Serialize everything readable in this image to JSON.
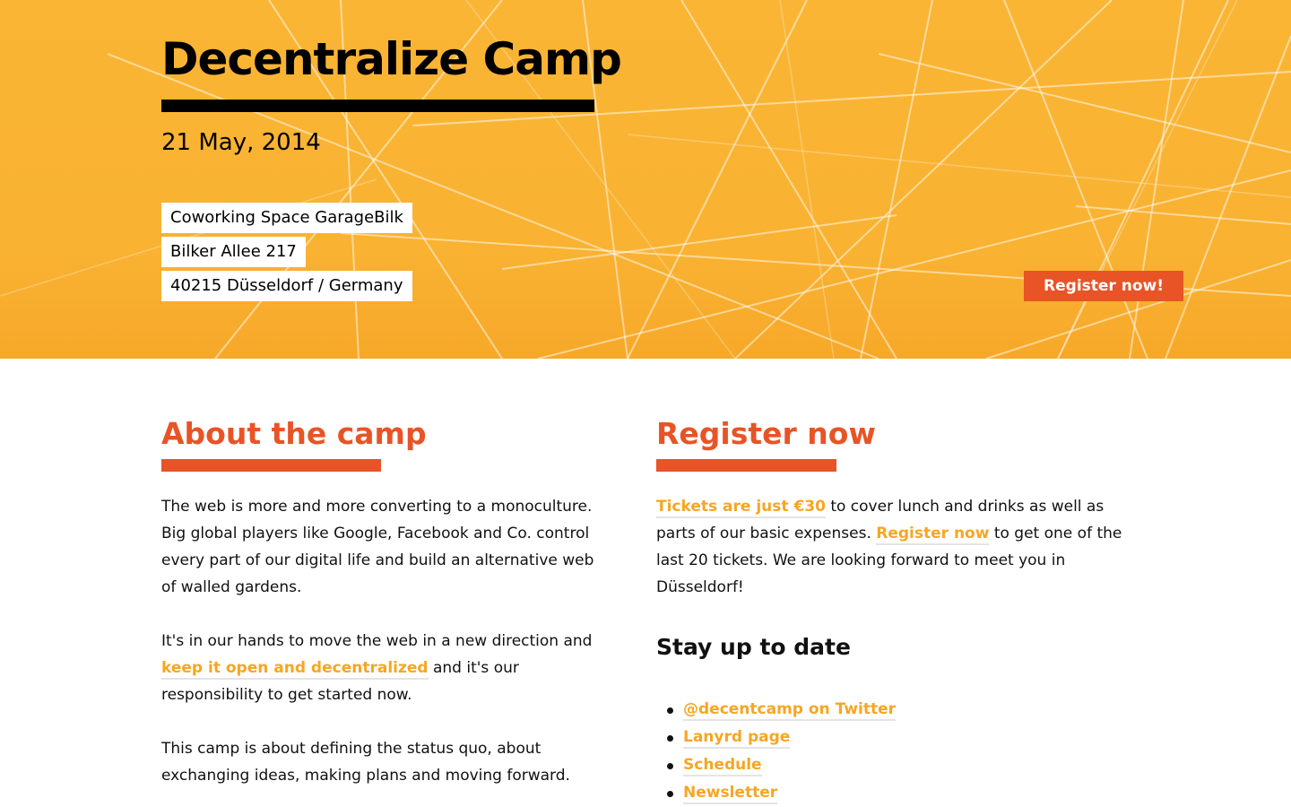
{
  "hero": {
    "title": "Decentralize Camp",
    "date": "21 May, 2014",
    "address": [
      "Coworking Space GarageBilk",
      "Bilker Allee 217",
      "40215 Düsseldorf / Germany"
    ],
    "cta_label": "Register now!"
  },
  "about": {
    "title": "About the camp",
    "p1": "The web is more and more converting to a monoculture. Big global players like Google, Facebook and Co. control every part of our digital life and build an alternative web of walled gardens.",
    "p2_before": "It's in our hands to move the web in a new direction and ",
    "p2_link": "keep it open and decentralized",
    "p2_after": " and it's our responsibility to get started now.",
    "p3": "This camp is about defining the status quo, about exchanging ideas, making plans and moving forward."
  },
  "register": {
    "title": "Register now",
    "tickets_link": "Tickets are just €30",
    "text1": " to cover lunch and drinks as well as parts of our basic expenses. ",
    "register_link": "Register now",
    "text2": " to get one of the last 20 tickets. We are looking forward to meet you in Düsseldorf!"
  },
  "updates": {
    "title": "Stay up to date",
    "links": [
      "@decentcamp on Twitter",
      "Lanyrd page",
      "Schedule",
      "Newsletter"
    ]
  },
  "colors": {
    "hero_background": "#fab535",
    "accent": "#e85425",
    "link": "#f6a623"
  }
}
